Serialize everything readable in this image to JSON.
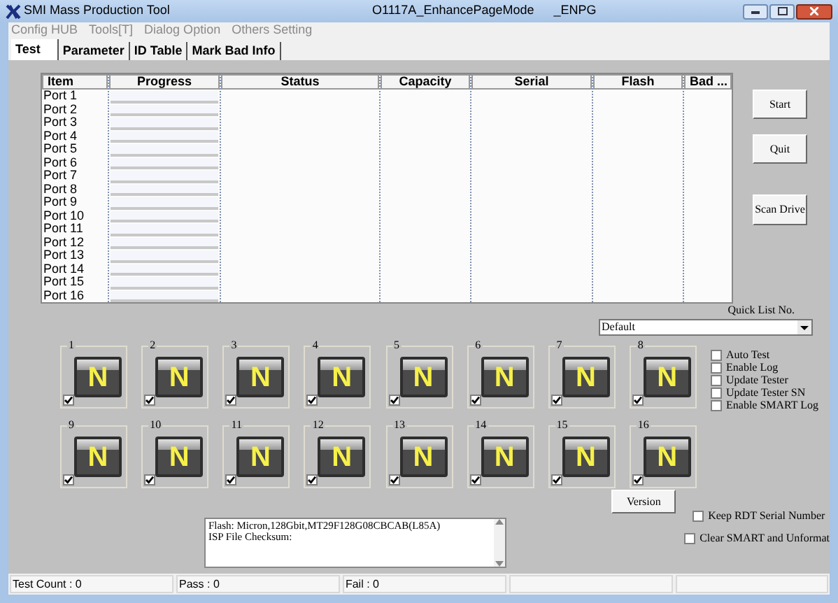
{
  "window": {
    "title": "SMI Mass Production Tool",
    "subtitle": "O1117A_EnhancePageMode",
    "suffix": "_ENPG"
  },
  "menu": [
    {
      "label": "Config HUB",
      "disabled": true
    },
    {
      "label": "Tools[T]",
      "disabled": true
    },
    {
      "label": "Dialog Option",
      "disabled": true
    },
    {
      "label": "Others Setting",
      "disabled": true
    }
  ],
  "tabs": [
    {
      "label": "Test",
      "selected": true
    },
    {
      "label": "Parameter",
      "selected": false
    },
    {
      "label": "ID Table",
      "selected": false
    },
    {
      "label": "Mark Bad Info",
      "selected": false
    }
  ],
  "table": {
    "columns": [
      "Item",
      "Progress",
      "Status",
      "Capacity",
      "Serial",
      "Flash",
      "Bad ..."
    ],
    "rows": [
      {
        "item": "Port 1",
        "level": 0
      },
      {
        "item": "Port 2",
        "level": 0
      },
      {
        "item": "Port 3",
        "level": 0
      },
      {
        "item": "Port 4",
        "level": 0
      },
      {
        "item": "Port 5",
        "level": 0
      },
      {
        "item": "Port 6",
        "level": 0
      },
      {
        "item": "Port 7",
        "level": 0
      },
      {
        "item": "Port 8",
        "level": 0
      },
      {
        "item": "Port 9",
        "level": 0
      },
      {
        "item": "Port 10",
        "level": 0
      },
      {
        "item": "Port 11",
        "level": 0
      },
      {
        "item": "Port 12",
        "level": 0
      },
      {
        "item": "Port 13",
        "level": 0
      },
      {
        "item": "Port 14",
        "level": 0
      },
      {
        "item": "Port 15",
        "level": 0
      },
      {
        "item": "Port 16",
        "level": 0
      }
    ]
  },
  "buttons": [
    "Start",
    "Quit",
    "Scan Drive"
  ],
  "quick_list": {
    "label": "Quick List No.",
    "value": "Default"
  },
  "ports": [
    {
      "label": "1",
      "status": "N",
      "checked": true
    },
    {
      "label": "2",
      "status": "N",
      "checked": true
    },
    {
      "label": "3",
      "status": "N",
      "checked": true
    },
    {
      "label": "4",
      "status": "N",
      "checked": true
    },
    {
      "label": "5",
      "status": "N",
      "checked": true
    },
    {
      "label": "6",
      "status": "N",
      "checked": true
    },
    {
      "label": "7",
      "status": "N",
      "checked": true
    },
    {
      "label": "8",
      "status": "N",
      "checked": true
    },
    {
      "label": "9",
      "status": "N",
      "checked": true
    },
    {
      "label": "10",
      "status": "N",
      "checked": true
    },
    {
      "label": "11",
      "status": "N",
      "checked": true
    },
    {
      "label": "12",
      "status": "N",
      "checked": true
    },
    {
      "label": "13",
      "status": "N",
      "checked": true
    },
    {
      "label": "14",
      "status": "N",
      "checked": true
    },
    {
      "label": "15",
      "status": "N",
      "checked": true
    },
    {
      "label": "16",
      "status": "N",
      "checked": true
    }
  ],
  "options": [
    {
      "label": "Auto Test",
      "checked": false
    },
    {
      "label": "Enable Log",
      "checked": false
    },
    {
      "label": "Update Tester",
      "checked": false
    },
    {
      "label": "Update Tester SN",
      "checked": false
    },
    {
      "label": "Enable SMART Log",
      "checked": false
    }
  ],
  "version_button": "Version",
  "extra_options": [
    {
      "label": "Keep RDT Serial Number",
      "checked": false
    },
    {
      "label": "Clear SMART and Unformat",
      "checked": false
    }
  ],
  "log": [
    "Flash: Micron,128Gbit,MT29F128G08CBCAB(L85A)",
    "ISP File Checksum:"
  ],
  "status_bar": [
    "Test Count : 0",
    "Pass : 0",
    "Fail : 0"
  ]
}
